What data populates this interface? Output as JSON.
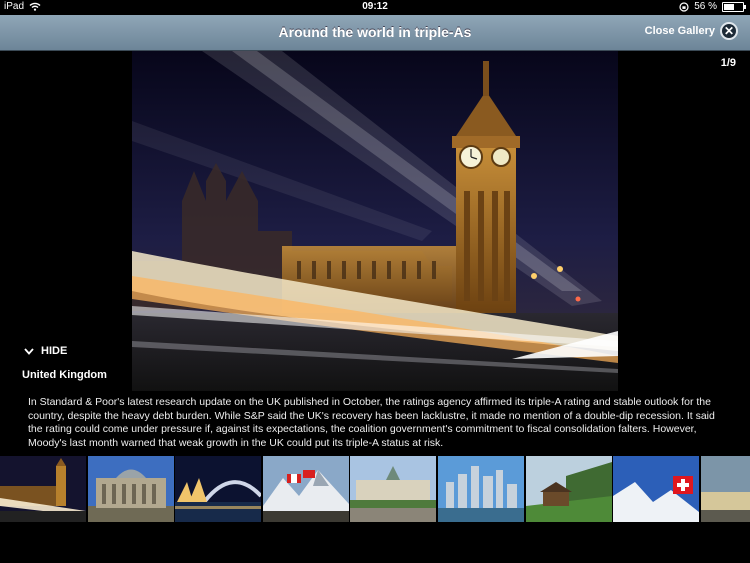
{
  "status": {
    "device": "iPad",
    "time": "09:12",
    "battery": "56 %",
    "battery_level": 0.56
  },
  "nav": {
    "title": "Around the world in triple-As",
    "close_label": "Close Gallery"
  },
  "gallery": {
    "counter": "1/9",
    "hide_label": "HIDE"
  },
  "caption": {
    "title": "United Kingdom",
    "text": "In Standard & Poor's latest research update on the UK published in October, the ratings agency affirmed its triple-A rating and stable outlook for the country, despite the heavy debt burden. While S&P said the UK's recovery has been lacklustre, it made no mention of a double-dip recession. It said the rating could come under pressure if, against its expectations, the coalition government's commitment to fiscal consolidation falters. However, Moody's last month warned that weak growth in the UK could put its triple-A status at risk."
  },
  "thumbnails": [
    {
      "name": "thumb-london"
    },
    {
      "name": "thumb-berlin"
    },
    {
      "name": "thumb-sydney"
    },
    {
      "name": "thumb-canada-mountains"
    },
    {
      "name": "thumb-denmark-palace"
    },
    {
      "name": "thumb-city-skyline"
    },
    {
      "name": "thumb-norway-cottage"
    },
    {
      "name": "thumb-switzerland"
    },
    {
      "name": "thumb-finland"
    }
  ]
}
